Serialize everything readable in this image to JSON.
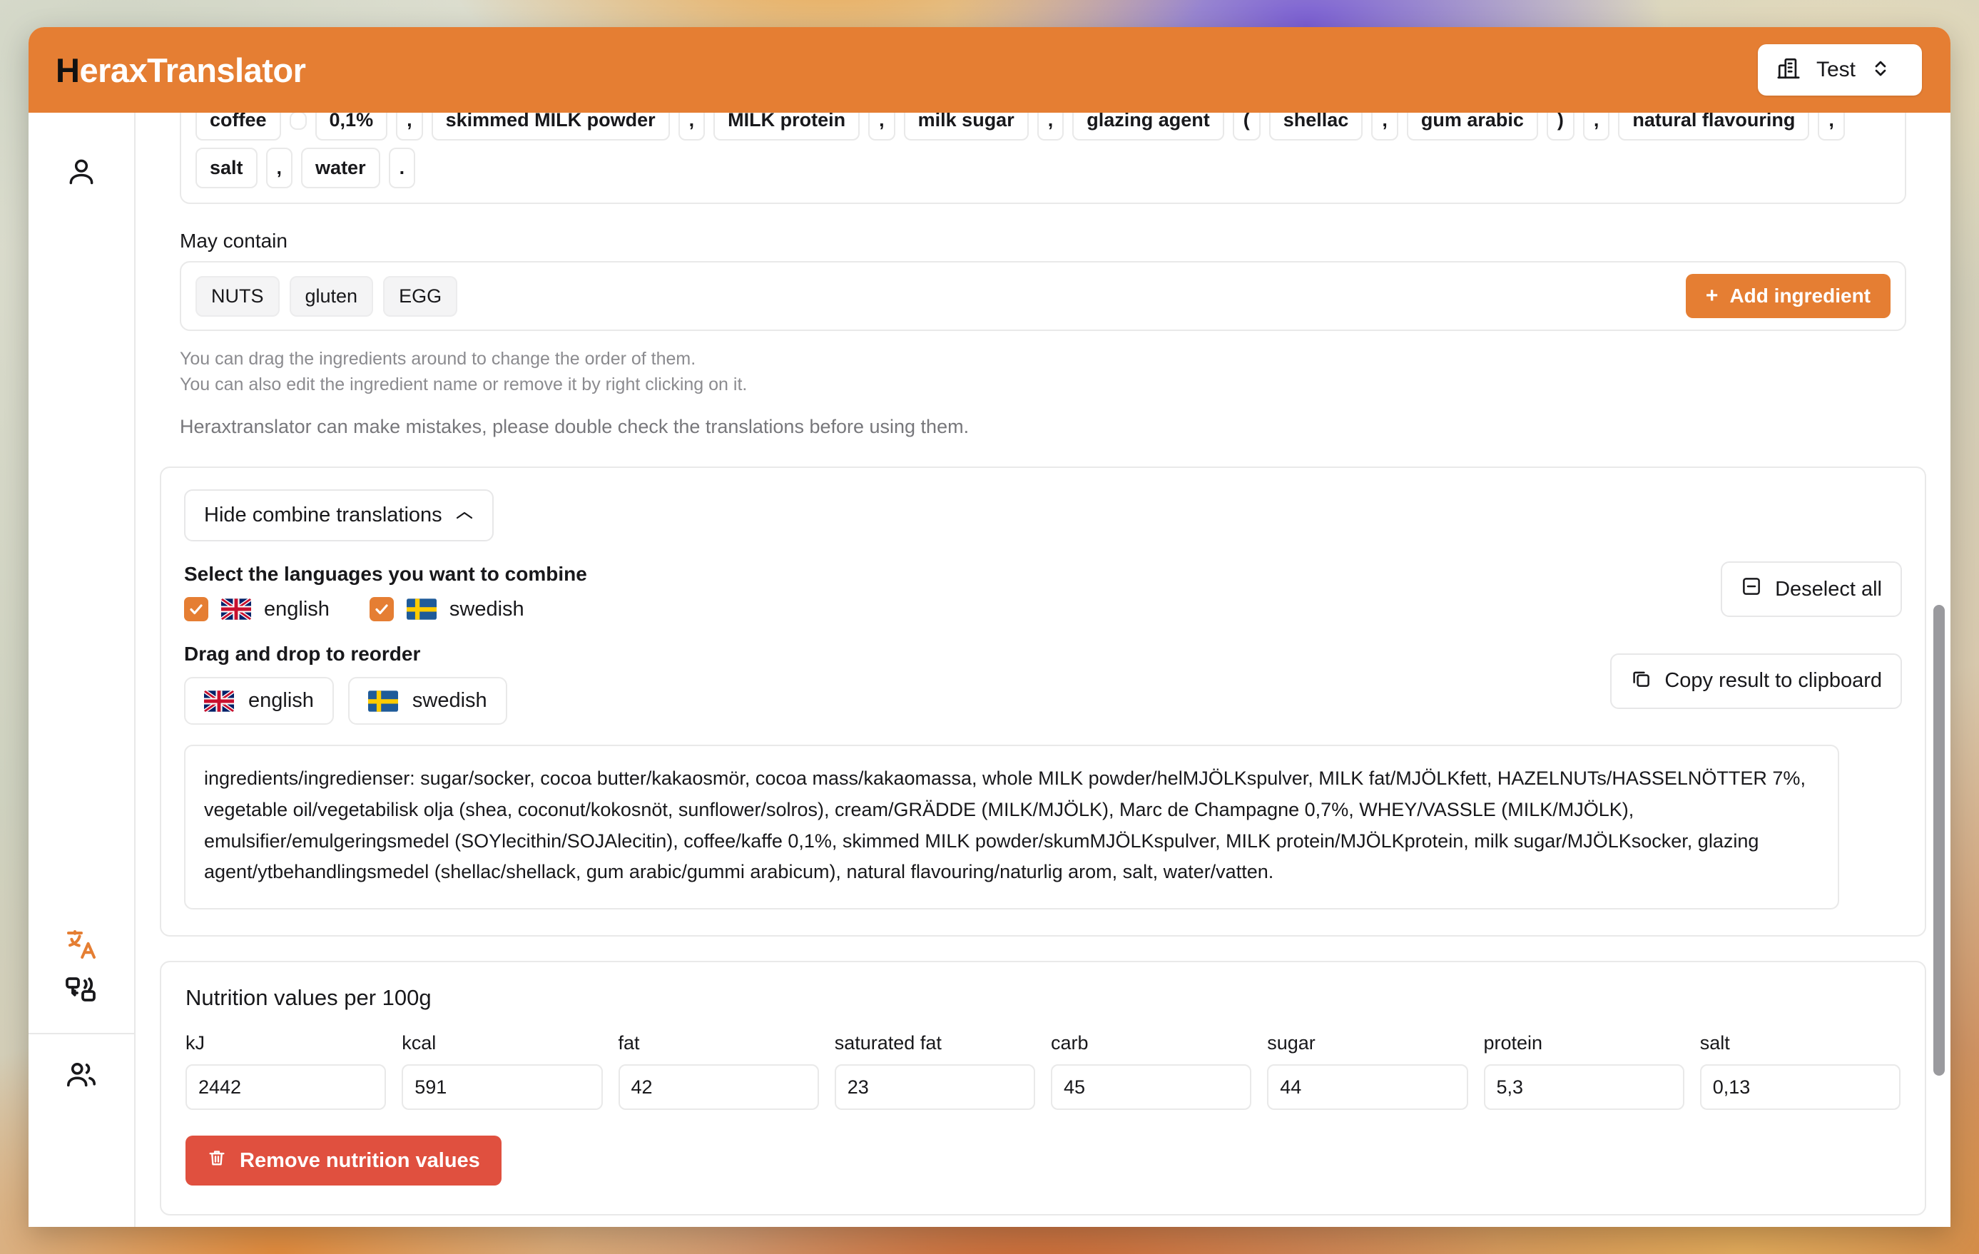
{
  "header": {
    "brand_initial": "H",
    "brand_rest": "eraxTranslator",
    "company_selector": {
      "label": "Test",
      "icon": "building-icon",
      "chevron": "chevron-up-down-icon"
    },
    "accent_color": "#e57e33"
  },
  "sidebar": {
    "items": [
      {
        "name": "profile",
        "icon": "user-icon",
        "active": false
      },
      {
        "name": "translate",
        "icon": "translate-icon",
        "active": true
      },
      {
        "name": "languages",
        "icon": "language-exchange-icon",
        "active": false
      },
      {
        "name": "team",
        "icon": "users-icon",
        "active": false
      }
    ]
  },
  "ingredients": {
    "tags": [
      "coffee",
      "",
      "0,1%",
      ",",
      "skimmed MILK powder",
      ",",
      "MILK protein",
      ",",
      "milk sugar",
      ",",
      "glazing agent",
      "(",
      "shellac",
      ",",
      "gum arabic",
      ")",
      ",",
      "natural flavouring",
      ",",
      "salt",
      ",",
      "water",
      "."
    ],
    "may_contain_label": "May contain",
    "may_contain_tags": [
      "NUTS",
      "gluten",
      "EGG"
    ],
    "add_ingredient_label": "Add ingredient",
    "add_ingredient_icon": "plus-icon",
    "hints": [
      "You can drag the ingredients around to change the order of them.",
      "You can also edit the ingredient name or remove it by right clicking on it."
    ],
    "disclaimer": "Heraxtranslator can make mistakes, please double check the translations before using them."
  },
  "combine": {
    "toggle_label": "Hide combine translations",
    "toggle_icon": "chevron-up-icon",
    "select_languages_label": "Select the languages you want to combine",
    "deselect_all_label": "Deselect all",
    "deselect_all_icon": "minus-square-icon",
    "reorder_label": "Drag and drop to reorder",
    "copy_label": "Copy result to clipboard",
    "copy_icon": "copy-icon",
    "languages": [
      {
        "code": "en",
        "label": "english",
        "checked": true,
        "flag": "uk-flag-icon"
      },
      {
        "code": "sv",
        "label": "swedish",
        "checked": true,
        "flag": "sweden-flag-icon"
      }
    ],
    "order": [
      {
        "code": "en",
        "label": "english",
        "flag": "uk-flag-icon"
      },
      {
        "code": "sv",
        "label": "swedish",
        "flag": "sweden-flag-icon"
      }
    ],
    "result_text": "ingredients/ingredienser: sugar/socker, cocoa butter/kakaosmör, cocoa mass/kakaomassa, whole MILK powder/helMJÖLKspulver, MILK fat/MJÖLKfett, HAZELNUTs/HASSELNÖTTER 7%, vegetable oil/vegetabilisk olja (shea, coconut/kokosnöt, sunflower/solros), cream/GRÄDDE (MILK/MJÖLK), Marc de Champagne 0,7%, WHEY/VASSLE (MILK/MJÖLK), emulsifier/emulgeringsmedel (SOYlecithin/SOJAlecitin), coffee/kaffe 0,1%, skimmed MILK powder/skumMJÖLKspulver, MILK protein/MJÖLKprotein, milk sugar/MJÖLKsocker, glazing agent/ytbehandlingsmedel (shellac/shellack, gum arabic/gummi arabicum), natural flavouring/naturlig arom, salt, water/vatten."
  },
  "nutrition": {
    "title": "Nutrition values per 100g",
    "fields": [
      {
        "label": "kJ",
        "value": "2442"
      },
      {
        "label": "kcal",
        "value": "591"
      },
      {
        "label": "fat",
        "value": "42"
      },
      {
        "label": "saturated fat",
        "value": "23"
      },
      {
        "label": "carb",
        "value": "45"
      },
      {
        "label": "sugar",
        "value": "44"
      },
      {
        "label": "protein",
        "value": "5,3"
      },
      {
        "label": "salt",
        "value": "0,13"
      }
    ],
    "remove_label": "Remove nutrition values",
    "remove_icon": "trash-icon",
    "danger_color": "#e0503f"
  }
}
